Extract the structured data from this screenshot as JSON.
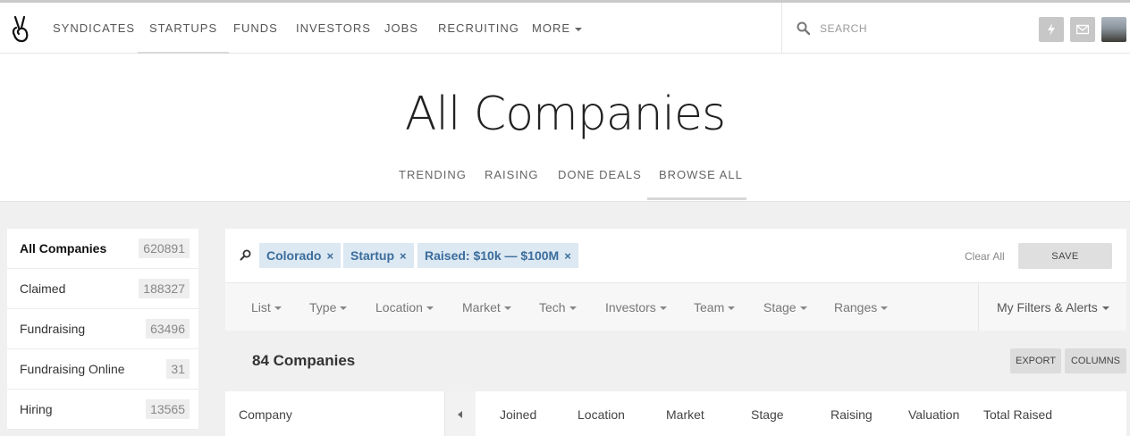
{
  "nav": {
    "items": [
      "SYNDICATES",
      "STARTUPS",
      "FUNDS",
      "INVESTORS",
      "JOBS",
      "RECRUITING",
      "MORE"
    ],
    "active": "STARTUPS",
    "search_placeholder": "SEARCH"
  },
  "hero": {
    "title": "All Companies",
    "tabs": [
      "TRENDING",
      "RAISING",
      "DONE DEALS",
      "BROWSE ALL"
    ],
    "active_tab": "BROWSE ALL"
  },
  "sidebar": {
    "items": [
      {
        "label": "All Companies",
        "count": "620891",
        "active": true
      },
      {
        "label": "Claimed",
        "count": "188327"
      },
      {
        "label": "Fundraising",
        "count": "63496"
      },
      {
        "label": "Fundraising Online",
        "count": "31"
      },
      {
        "label": "Hiring",
        "count": "13565"
      }
    ]
  },
  "filters": {
    "chips": [
      "Colorado",
      "Startup",
      "Raised: $10k — $100M"
    ],
    "remove_glyph": "×",
    "clear_all": "Clear All",
    "save": "SAVE"
  },
  "dropdowns": {
    "items": [
      "List",
      "Type",
      "Location",
      "Market",
      "Tech",
      "Investors",
      "Team",
      "Stage",
      "Ranges"
    ],
    "my_filters": "My Filters & Alerts"
  },
  "results": {
    "count_label": "84 Companies",
    "export": "EXPORT",
    "columns": "COLUMNS"
  },
  "table": {
    "company_header": "Company",
    "headers": [
      "Joined",
      "Location",
      "Market",
      "Stage",
      "Raising",
      "Valuation",
      "Total Raised"
    ]
  },
  "colors": {
    "chip_bg": "#dce8f2",
    "chip_text": "#3b6d9c",
    "background": "#f0f0f0"
  },
  "icons": {
    "logo": "victory-hand-icon",
    "search": "search-icon",
    "notifications": "lightning-icon",
    "messages": "envelope-icon"
  }
}
